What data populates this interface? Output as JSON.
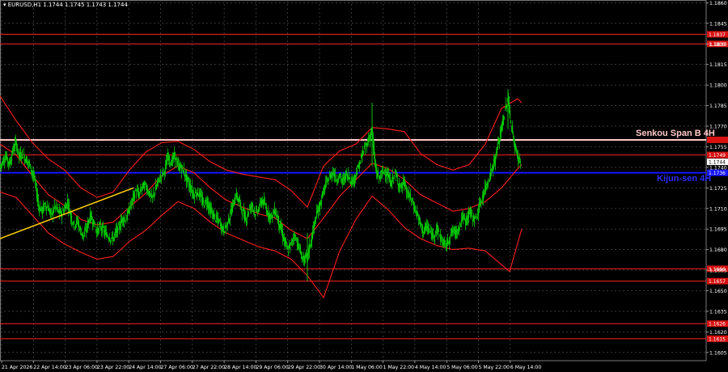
{
  "header": {
    "symbol_line": "▾ EURUSD,H1  1.1744 1.1745 1.1743 1.1744"
  },
  "annotations": {
    "senkou_label": "Senkou Span B 4H",
    "kijun_label": "Kijun-sen 4H"
  },
  "colors": {
    "background": "#000000",
    "grid": "#5a5a5a",
    "candle_bull": "#00c800",
    "candle_bear": "#00c800",
    "bollinger": "#ff1e1e",
    "level": "#ff2020",
    "senkou": "#ffc8c8",
    "kijun": "#1414ff",
    "trendline": "#ffd200",
    "axis_text": "#ffffff"
  },
  "chart_data": {
    "type": "candlestick",
    "symbol": "EURUSD",
    "timeframe": "H1",
    "last_price": 1.1744,
    "ylim": [
      1.1599,
      1.1862
    ],
    "y_ticks": [
      1.1605,
      1.162,
      1.1635,
      1.165,
      1.1665,
      1.168,
      1.1695,
      1.171,
      1.1725,
      1.174,
      1.1755,
      1.177,
      1.1785,
      1.18,
      1.1815,
      1.183,
      1.1845,
      1.186
    ],
    "x_ticks": [
      "21 Apr 2026",
      "22 Apr 14:00",
      "23 Apr 06:00",
      "23 Apr 22:00",
      "24 Apr 14:00",
      "27 Apr 06:00",
      "27 Apr 22:00",
      "28 Apr 14:00",
      "29 Apr 06:00",
      "29 Apr 22:00",
      "30 Apr 14:00",
      "1 May 06:00",
      "1 May 22:00",
      "4 May 14:00",
      "5 May 06:00",
      "5 May 22:00",
      "6 May 14:00"
    ],
    "horizontal_levels": [
      {
        "name": "level",
        "value": 1.1837
      },
      {
        "name": "level",
        "value": 1.183
      },
      {
        "name": "level",
        "value": 1.1749
      },
      {
        "name": "level",
        "value": 1.1666
      },
      {
        "name": "level",
        "value": 1.1657
      },
      {
        "name": "level",
        "value": 1.1626
      },
      {
        "name": "level",
        "value": 1.1615
      }
    ],
    "senkou_span_b_4h": 1.176,
    "kijun_sen_4h": 1.1736,
    "price_series": [
      [
        0,
        1.174
      ],
      [
        4,
        1.1745
      ],
      [
        8,
        1.1748
      ],
      [
        12,
        1.1742
      ],
      [
        16,
        1.1752
      ],
      [
        20,
        1.1758
      ],
      [
        24,
        1.1748
      ],
      [
        28,
        1.175
      ],
      [
        32,
        1.1746
      ],
      [
        36,
        1.1743
      ],
      [
        40,
        1.1737
      ],
      [
        44,
        1.1728
      ],
      [
        48,
        1.1712
      ],
      [
        52,
        1.1708
      ],
      [
        56,
        1.1713
      ],
      [
        60,
        1.171
      ],
      [
        64,
        1.1705
      ],
      [
        68,
        1.1712
      ],
      [
        72,
        1.1708
      ],
      [
        76,
        1.1706
      ],
      [
        80,
        1.171
      ],
      [
        84,
        1.1715
      ],
      [
        88,
        1.1704
      ],
      [
        92,
        1.1698
      ],
      [
        96,
        1.1701
      ],
      [
        100,
        1.1693
      ],
      [
        104,
        1.169
      ],
      [
        108,
        1.1697
      ],
      [
        112,
        1.1705
      ],
      [
        116,
        1.17
      ],
      [
        120,
        1.1693
      ],
      [
        124,
        1.1697
      ],
      [
        128,
        1.1694
      ],
      [
        132,
        1.1691
      ],
      [
        136,
        1.1689
      ],
      [
        140,
        1.1688
      ],
      [
        144,
        1.1693
      ],
      [
        148,
        1.1697
      ],
      [
        152,
        1.1703
      ],
      [
        156,
        1.1702
      ],
      [
        160,
        1.1709
      ],
      [
        164,
        1.1716
      ],
      [
        168,
        1.1723
      ],
      [
        172,
        1.172
      ],
      [
        176,
        1.1726
      ],
      [
        180,
        1.1727
      ],
      [
        184,
        1.1722
      ],
      [
        188,
        1.1717
      ],
      [
        192,
        1.1723
      ],
      [
        196,
        1.173
      ],
      [
        200,
        1.1735
      ],
      [
        204,
        1.1738
      ],
      [
        208,
        1.1748
      ],
      [
        212,
        1.1743
      ],
      [
        216,
        1.1749
      ],
      [
        220,
        1.1741
      ],
      [
        224,
        1.174
      ],
      [
        228,
        1.1736
      ],
      [
        232,
        1.173
      ],
      [
        236,
        1.1725
      ],
      [
        240,
        1.172
      ],
      [
        244,
        1.1722
      ],
      [
        248,
        1.1719
      ],
      [
        252,
        1.1713
      ],
      [
        256,
        1.1716
      ],
      [
        260,
        1.1709
      ],
      [
        264,
        1.1705
      ],
      [
        268,
        1.1702
      ],
      [
        272,
        1.17
      ],
      [
        276,
        1.1694
      ],
      [
        280,
        1.1697
      ],
      [
        284,
        1.1704
      ],
      [
        288,
        1.1712
      ],
      [
        292,
        1.172
      ],
      [
        296,
        1.1715
      ],
      [
        300,
        1.1708
      ],
      [
        304,
        1.1702
      ],
      [
        308,
        1.1709
      ],
      [
        312,
        1.1713
      ],
      [
        316,
        1.1706
      ],
      [
        320,
        1.171
      ],
      [
        324,
        1.1716
      ],
      [
        328,
        1.1712
      ],
      [
        332,
        1.1706
      ],
      [
        336,
        1.1704
      ],
      [
        340,
        1.1709
      ],
      [
        344,
        1.1702
      ],
      [
        348,
        1.1694
      ],
      [
        352,
        1.1686
      ],
      [
        356,
        1.1679
      ],
      [
        360,
        1.1684
      ],
      [
        364,
        1.1691
      ],
      [
        368,
        1.1685
      ],
      [
        372,
        1.1677
      ],
      [
        376,
        1.1672
      ],
      [
        380,
        1.1675
      ],
      [
        384,
        1.1684
      ],
      [
        388,
        1.1696
      ],
      [
        392,
        1.1706
      ],
      [
        396,
        1.1713
      ],
      [
        400,
        1.1722
      ],
      [
        404,
        1.1729
      ],
      [
        408,
        1.1733
      ],
      [
        412,
        1.1737
      ],
      [
        416,
        1.1731
      ],
      [
        420,
        1.1734
      ],
      [
        424,
        1.1729
      ],
      [
        428,
        1.1735
      ],
      [
        432,
        1.1733
      ],
      [
        436,
        1.1729
      ],
      [
        440,
        1.1735
      ],
      [
        444,
        1.1741
      ],
      [
        448,
        1.1749
      ],
      [
        452,
        1.1755
      ],
      [
        456,
        1.176
      ],
      [
        460,
        1.1767
      ],
      [
        464,
        1.1741
      ],
      [
        468,
        1.1732
      ],
      [
        472,
        1.1735
      ],
      [
        476,
        1.1738
      ],
      [
        480,
        1.1733
      ],
      [
        484,
        1.1728
      ],
      [
        488,
        1.1736
      ],
      [
        492,
        1.173
      ],
      [
        496,
        1.1725
      ],
      [
        500,
        1.1729
      ],
      [
        504,
        1.172
      ],
      [
        508,
        1.1718
      ],
      [
        512,
        1.1711
      ],
      [
        516,
        1.1706
      ],
      [
        520,
        1.1698
      ],
      [
        524,
        1.1693
      ],
      [
        528,
        1.1697
      ],
      [
        532,
        1.1692
      ],
      [
        536,
        1.169
      ],
      [
        540,
        1.1696
      ],
      [
        544,
        1.169
      ],
      [
        548,
        1.1685
      ],
      [
        552,
        1.1683
      ],
      [
        556,
        1.1689
      ],
      [
        560,
        1.1694
      ],
      [
        564,
        1.1692
      ],
      [
        568,
        1.1697
      ],
      [
        572,
        1.1704
      ],
      [
        576,
        1.17
      ],
      [
        580,
        1.1708
      ],
      [
        584,
        1.1704
      ],
      [
        588,
        1.1702
      ],
      [
        592,
        1.1709
      ],
      [
        596,
        1.1717
      ],
      [
        600,
        1.1724
      ],
      [
        604,
        1.1731
      ],
      [
        608,
        1.1738
      ],
      [
        612,
        1.1745
      ],
      [
        616,
        1.1756
      ],
      [
        620,
        1.1768
      ],
      [
        624,
        1.1779
      ],
      [
        628,
        1.1791
      ],
      [
        632,
        1.1772
      ],
      [
        636,
        1.1757
      ],
      [
        640,
        1.1748
      ],
      [
        644,
        1.1744
      ]
    ],
    "bollinger_upper": [
      [
        0,
        1.1792
      ],
      [
        20,
        1.1774
      ],
      [
        40,
        1.1758
      ],
      [
        60,
        1.1746
      ],
      [
        80,
        1.1738
      ],
      [
        100,
        1.1725
      ],
      [
        120,
        1.1718
      ],
      [
        140,
        1.1722
      ],
      [
        160,
        1.1738
      ],
      [
        180,
        1.1751
      ],
      [
        200,
        1.1758
      ],
      [
        220,
        1.1759
      ],
      [
        240,
        1.1753
      ],
      [
        260,
        1.1744
      ],
      [
        280,
        1.1738
      ],
      [
        300,
        1.1735
      ],
      [
        320,
        1.1733
      ],
      [
        340,
        1.1731
      ],
      [
        360,
        1.1723
      ],
      [
        380,
        1.1711
      ],
      [
        400,
        1.1741
      ],
      [
        420,
        1.1752
      ],
      [
        440,
        1.1757
      ],
      [
        460,
        1.1769
      ],
      [
        480,
        1.1768
      ],
      [
        500,
        1.1766
      ],
      [
        520,
        1.175
      ],
      [
        540,
        1.1742
      ],
      [
        560,
        1.1738
      ],
      [
        580,
        1.1742
      ],
      [
        600,
        1.1757
      ],
      [
        620,
        1.1783
      ],
      [
        640,
        1.179
      ],
      [
        645,
        1.1787
      ]
    ],
    "bollinger_middle": [
      [
        0,
        1.1757
      ],
      [
        20,
        1.1749
      ],
      [
        40,
        1.1734
      ],
      [
        60,
        1.172
      ],
      [
        80,
        1.1712
      ],
      [
        100,
        1.1702
      ],
      [
        120,
        1.1698
      ],
      [
        140,
        1.17
      ],
      [
        160,
        1.1711
      ],
      [
        180,
        1.1721
      ],
      [
        200,
        1.1734
      ],
      [
        220,
        1.1741
      ],
      [
        240,
        1.1736
      ],
      [
        260,
        1.1725
      ],
      [
        280,
        1.1716
      ],
      [
        300,
        1.1711
      ],
      [
        320,
        1.1706
      ],
      [
        340,
        1.1703
      ],
      [
        360,
        1.1694
      ],
      [
        380,
        1.1688
      ],
      [
        400,
        1.1703
      ],
      [
        420,
        1.1719
      ],
      [
        440,
        1.1731
      ],
      [
        460,
        1.1743
      ],
      [
        480,
        1.1739
      ],
      [
        500,
        1.1731
      ],
      [
        520,
        1.172
      ],
      [
        540,
        1.1714
      ],
      [
        560,
        1.1708
      ],
      [
        580,
        1.171
      ],
      [
        600,
        1.1715
      ],
      [
        620,
        1.1725
      ],
      [
        640,
        1.1739
      ],
      [
        645,
        1.1742
      ]
    ],
    "bollinger_lower": [
      [
        0,
        1.1722
      ],
      [
        20,
        1.1718
      ],
      [
        40,
        1.1705
      ],
      [
        60,
        1.1692
      ],
      [
        80,
        1.1684
      ],
      [
        100,
        1.1678
      ],
      [
        120,
        1.1673
      ],
      [
        140,
        1.1675
      ],
      [
        160,
        1.1686
      ],
      [
        180,
        1.1694
      ],
      [
        200,
        1.1705
      ],
      [
        220,
        1.1715
      ],
      [
        240,
        1.171
      ],
      [
        260,
        1.17
      ],
      [
        280,
        1.1692
      ],
      [
        300,
        1.1687
      ],
      [
        320,
        1.1682
      ],
      [
        340,
        1.1679
      ],
      [
        360,
        1.1673
      ],
      [
        380,
        1.1661
      ],
      [
        400,
        1.1645
      ],
      [
        420,
        1.1679
      ],
      [
        440,
        1.1702
      ],
      [
        460,
        1.1719
      ],
      [
        480,
        1.1709
      ],
      [
        500,
        1.1696
      ],
      [
        520,
        1.1688
      ],
      [
        540,
        1.1683
      ],
      [
        560,
        1.168
      ],
      [
        580,
        1.1681
      ],
      [
        600,
        1.1679
      ],
      [
        620,
        1.1669
      ],
      [
        630,
        1.1664
      ],
      [
        645,
        1.1695
      ]
    ],
    "trendline": {
      "from": [
        0,
        1.1688
      ],
      "to": [
        165,
        1.1725
      ]
    }
  }
}
